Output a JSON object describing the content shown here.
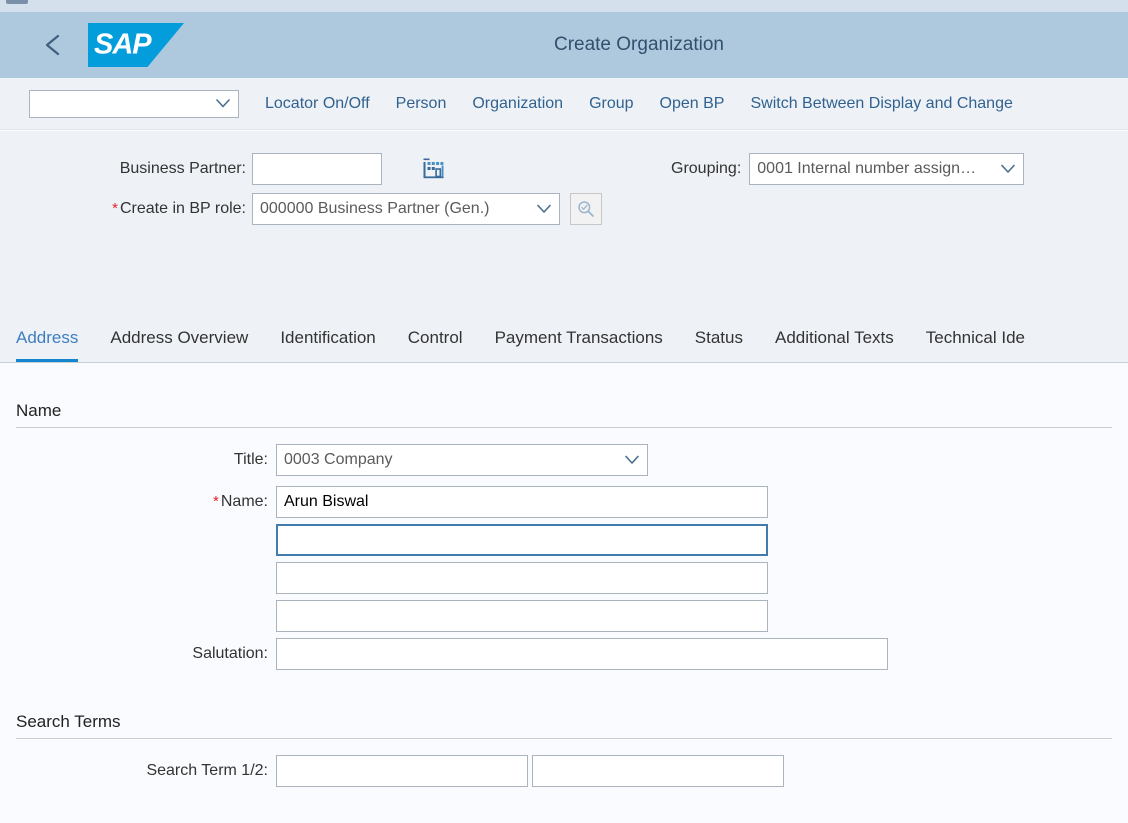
{
  "window": {
    "title": "Create Organization"
  },
  "header": {
    "back_icon": "chevron-left-icon",
    "logo_text": "SAP",
    "title": "Create Organization"
  },
  "toolbar": {
    "system_select_value": "",
    "links": [
      {
        "label": "Locator On/Off"
      },
      {
        "label": "Person"
      },
      {
        "label": "Organization"
      },
      {
        "label": "Group"
      },
      {
        "label": "Open BP"
      },
      {
        "label": "Switch Between Display and Change"
      }
    ]
  },
  "form_header": {
    "business_partner": {
      "label": "Business Partner:",
      "value": "",
      "icon": "organization-building-icon"
    },
    "create_in_bp_role": {
      "label": "Create in BP role:",
      "required": true,
      "value": "000000 Business Partner (Gen.)",
      "search_icon": "magnifier-icon"
    },
    "grouping": {
      "label": "Grouping:",
      "value": "0001 Internal number assign…"
    }
  },
  "tabs": [
    {
      "label": "Address",
      "active": true
    },
    {
      "label": "Address Overview",
      "active": false
    },
    {
      "label": "Identification",
      "active": false
    },
    {
      "label": "Control",
      "active": false
    },
    {
      "label": "Payment Transactions",
      "active": false
    },
    {
      "label": "Status",
      "active": false
    },
    {
      "label": "Additional Texts",
      "active": false
    },
    {
      "label": "Technical Ide",
      "active": false
    }
  ],
  "address_tab": {
    "name_section": {
      "heading": "Name",
      "title_label": "Title:",
      "title_value": "0003 Company",
      "name_label": "Name:",
      "name_required": true,
      "name_value_1": "Arun Biswal",
      "name_value_2": "",
      "name_value_3": "",
      "name_value_4": "",
      "salutation_label": "Salutation:",
      "salutation_value": ""
    },
    "search_terms_section": {
      "heading": "Search Terms",
      "search_term_label": "Search Term 1/2:",
      "search_term_1": "",
      "search_term_2": ""
    }
  },
  "colors": {
    "header_bar": "#aec8de",
    "toolbar_bg": "#eef2f7",
    "content_bg": "#fafbfe",
    "accent_blue": "#1287d0",
    "link_blue": "#31628f",
    "sap_logo_blue": "#049ddc",
    "required_red": "#e4242a",
    "focus_border": "#427cac"
  }
}
